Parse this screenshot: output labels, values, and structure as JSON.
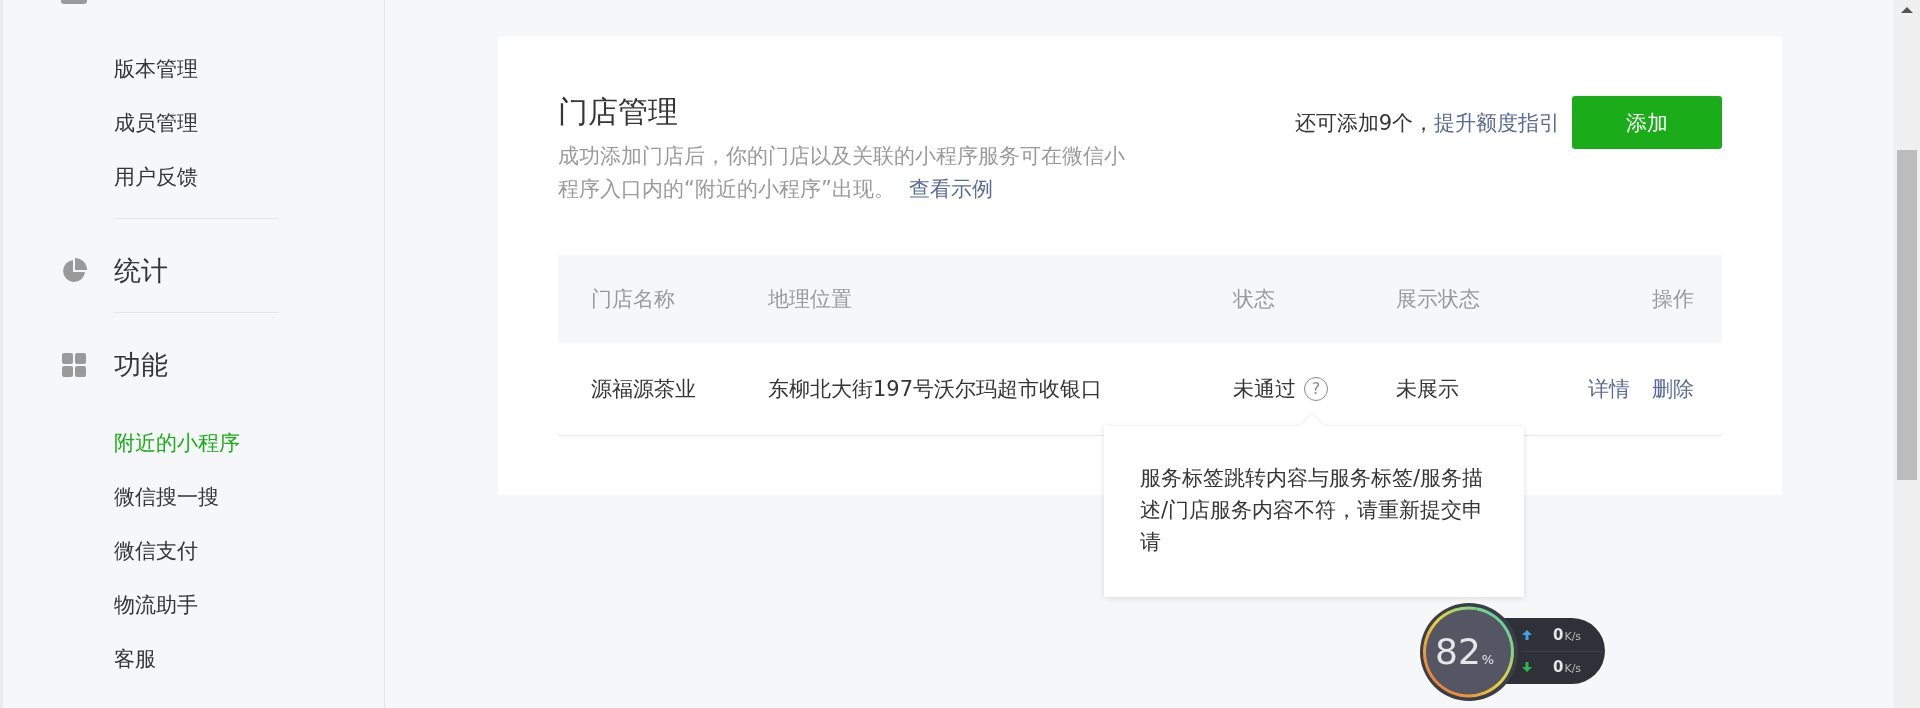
{
  "sidebar": {
    "sections": [
      {
        "kind": "manage",
        "items": [
          {
            "label": "版本管理",
            "selected": false
          },
          {
            "label": "成员管理",
            "selected": false
          },
          {
            "label": "用户反馈",
            "selected": false
          }
        ]
      },
      {
        "title": "统计",
        "kind": "stats"
      },
      {
        "title": "功能",
        "kind": "features",
        "items": [
          {
            "label": "附近的小程序",
            "selected": true
          },
          {
            "label": "微信搜一搜",
            "selected": false
          },
          {
            "label": "微信支付",
            "selected": false
          },
          {
            "label": "物流助手",
            "selected": false
          },
          {
            "label": "客服",
            "selected": false
          }
        ]
      }
    ]
  },
  "main": {
    "title": "门店管理",
    "description": "成功添加门店后，你的门店以及关联的小程序服务可在微信小程序入口内的“附近的小程序”出现。",
    "description_link": "查看示例",
    "quota": "还可添加9个，",
    "quota_link": "提升额度指引",
    "add_button": "添加"
  },
  "table": {
    "columns": [
      "门店名称",
      "地理位置",
      "状态",
      "展示状态",
      "操作"
    ],
    "rows": [
      {
        "name": "源福源茶业",
        "location": "东柳北大街197号沃尔玛超市收银口",
        "status": "未通过",
        "status_help": "?",
        "display_status": "未展示",
        "actions": [
          "详情",
          "删除"
        ]
      }
    ]
  },
  "tooltip": {
    "text": "服务标签跳转内容与服务标签/服务描述/门店服务内容不符，请重新提交申请"
  },
  "net_widget": {
    "percent": "82",
    "percent_unit": "%",
    "upload": {
      "value": "0",
      "unit": "K/s"
    },
    "download": {
      "value": "0",
      "unit": "K/s"
    }
  }
}
